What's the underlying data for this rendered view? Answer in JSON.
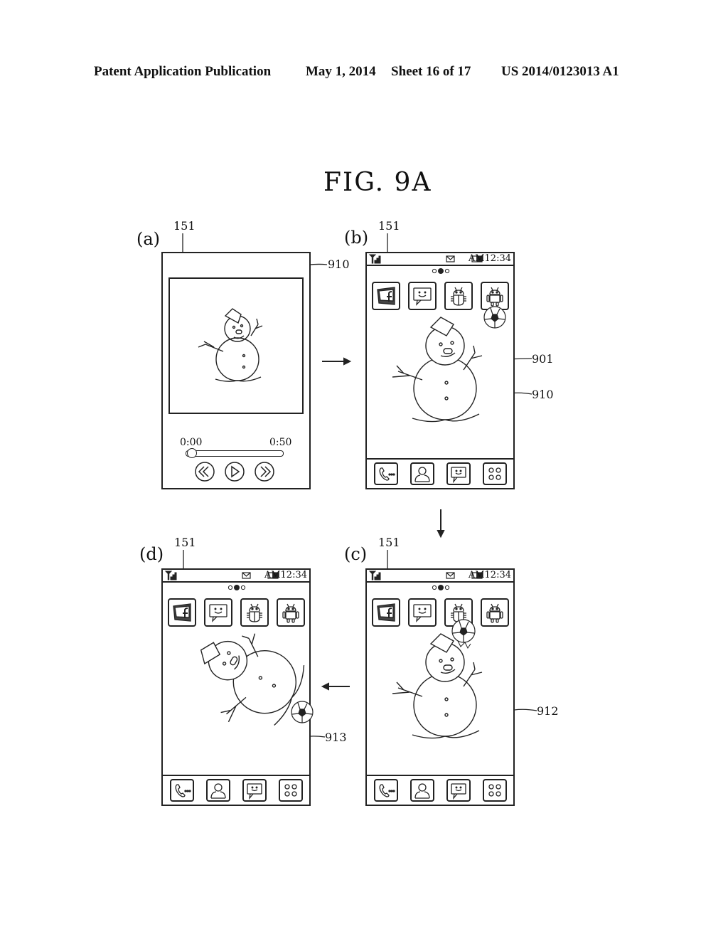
{
  "header": {
    "left": "Patent Application Publication",
    "date": "May 1, 2014",
    "sheet": "Sheet 16 of 17",
    "number": "US 2014/0123013 A1"
  },
  "figure_title": "FIG. 9A",
  "panels": {
    "a": {
      "label": "(a)",
      "ref_display": "151",
      "ref_screen": "910",
      "player": {
        "time_start": "0:00",
        "time_end": "0:50",
        "progress": 0.0
      }
    },
    "b": {
      "label": "(b)",
      "ref_display": "151",
      "ref_object": "901",
      "ref_screen": "910",
      "status": {
        "time": "AM12:34",
        "page_indicator_active": 2,
        "page_count": 3
      },
      "apps": [
        "facebook",
        "messaging",
        "android-bug",
        "android"
      ],
      "dock": [
        "phone",
        "contacts",
        "messaging",
        "app-drawer"
      ]
    },
    "c": {
      "label": "(c)",
      "ref_display": "151",
      "ref_screen": "912",
      "status": {
        "time": "AM12:34",
        "page_indicator_active": 2,
        "page_count": 3
      },
      "apps": [
        "facebook",
        "messaging",
        "android-bug",
        "android"
      ],
      "dock": [
        "phone",
        "contacts",
        "messaging",
        "app-drawer"
      ]
    },
    "d": {
      "label": "(d)",
      "ref_display": "151",
      "ref_screen": "913",
      "status": {
        "time": "AM12:34",
        "page_indicator_active": 2,
        "page_count": 3
      },
      "apps": [
        "facebook",
        "messaging",
        "android-bug",
        "android"
      ],
      "dock": [
        "phone",
        "contacts",
        "messaging",
        "app-drawer"
      ]
    }
  }
}
